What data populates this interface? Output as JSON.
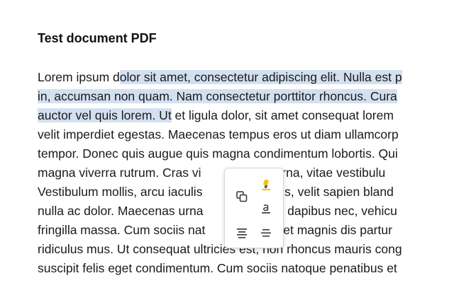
{
  "document": {
    "title": "Test document PDF",
    "paragraph_lines": [
      {
        "before": "Lorem ipsum d",
        "selected": "olor sit amet, consectetur adipiscing elit. Nulla est p",
        "after": ""
      },
      {
        "before": "",
        "selected": "in, accumsan non quam. Nam consectetur porttitor rhoncus. Cura",
        "after": ""
      },
      {
        "before": "",
        "selected": "auctor vel quis lorem. Ut",
        "after": " et ligula dolor, sit amet consequat lorem"
      },
      {
        "before": "velit imperdiet egestas. Maecenas tempus eros ut diam ullamcorp",
        "selected": "",
        "after": ""
      },
      {
        "before": "tempor. Donec quis augue quis magna condimentum lobortis. Qui",
        "selected": "",
        "after": ""
      },
      {
        "before": "magna viverra rutrum. Cras vi          olestie urna, vitae vestibulu",
        "selected": "",
        "after": ""
      },
      {
        "before": "Vestibulum mollis, arcu iaculis          um varius, velit sapien bland",
        "selected": "",
        "after": ""
      },
      {
        "before": "nulla ac dolor. Maecenas urna          cidunt in dapibus nec, vehicu",
        "selected": "",
        "after": ""
      },
      {
        "before": "fringilla massa. Cum sociis nat          natibus et magnis dis partur",
        "selected": "",
        "after": ""
      },
      {
        "before": "ridiculus mus. Ut consequat ultricies est, non rhoncus mauris cong",
        "selected": "",
        "after": ""
      },
      {
        "before": "suscipit felis eget condimentum. Cum sociis natoque penatibus et",
        "selected": "",
        "after": ""
      }
    ]
  },
  "selection_popover": {
    "buttons": [
      {
        "name": "highlight-button",
        "icon": "highlighter-icon"
      },
      {
        "name": "copy-button",
        "icon": "copy-icon"
      },
      {
        "name": "underline-button",
        "icon": "underline-icon"
      },
      {
        "name": "comment-button",
        "icon": "text-lines-icon"
      },
      {
        "name": "strikethrough-button",
        "icon": "strikethrough-icon"
      }
    ]
  },
  "colors": {
    "selection": "#d3e0f0",
    "highlighter": "#f1c40f",
    "icon": "#333333"
  }
}
